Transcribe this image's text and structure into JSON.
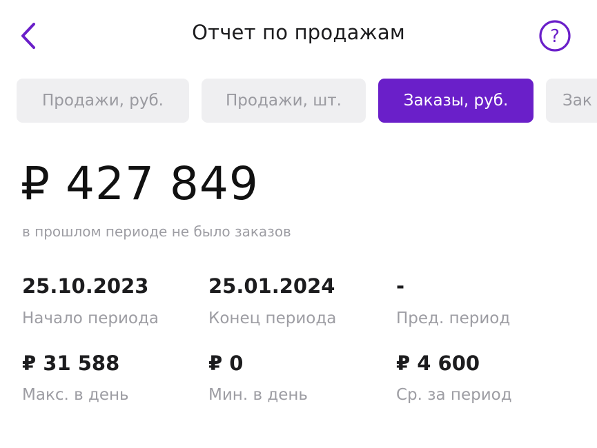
{
  "header": {
    "title": "Отчет по продажам",
    "back_icon": "chevron-left-icon",
    "help_icon": "question-circle-icon",
    "help_label": "?"
  },
  "accent_color": "#6a1fc9",
  "tabs": [
    {
      "label": "Продажи, руб.",
      "active": false
    },
    {
      "label": "Продажи, шт.",
      "active": false
    },
    {
      "label": "Заказы, руб.",
      "active": true
    },
    {
      "label": "Зак",
      "active": false
    }
  ],
  "summary": {
    "total": "₽ 427 849",
    "comparison_note": "в прошлом периоде не было заказов"
  },
  "stats": [
    {
      "value": "25.10.2023",
      "label": "Начало периода"
    },
    {
      "value": "25.01.2024",
      "label": "Конец периода"
    },
    {
      "value": "-",
      "label": "Пред. период"
    },
    {
      "value": "₽ 31 588",
      "label": "Макс. в день"
    },
    {
      "value": "₽ 0",
      "label": "Мин. в день"
    },
    {
      "value": "₽ 4 600",
      "label": "Ср. за период"
    }
  ]
}
